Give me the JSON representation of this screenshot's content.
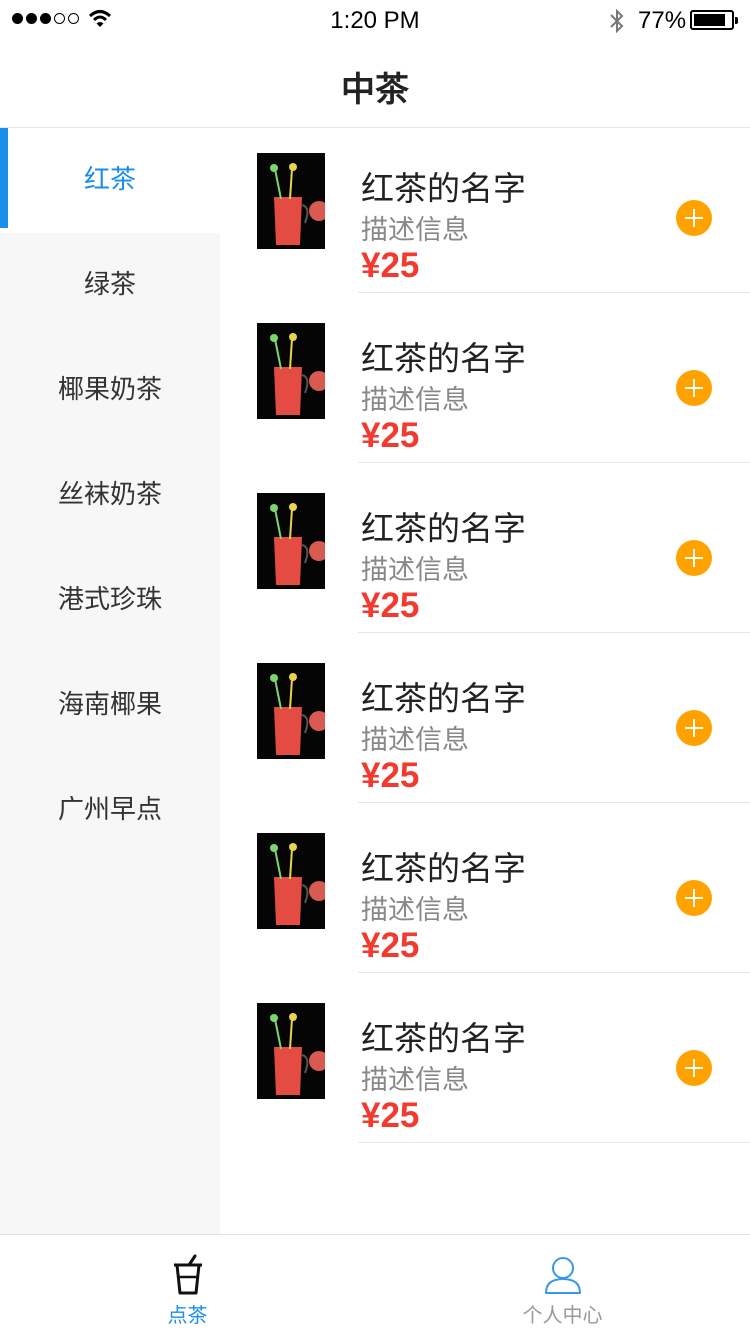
{
  "status_bar": {
    "time": "1:20 PM",
    "battery_percent": "77%",
    "battery_level": 0.77,
    "signal_bars_filled": 3,
    "signal_bars_total": 5,
    "icons": [
      "signal-dots-icon",
      "wifi-icon",
      "bluetooth-icon",
      "battery-icon"
    ]
  },
  "header": {
    "title": "中茶"
  },
  "sidebar": {
    "active_index": 0,
    "items": [
      {
        "label": "红茶"
      },
      {
        "label": "绿茶"
      },
      {
        "label": "椰果奶茶"
      },
      {
        "label": "丝袜奶茶"
      },
      {
        "label": "港式珍珠"
      },
      {
        "label": "海南椰果"
      },
      {
        "label": "广州早点"
      }
    ]
  },
  "products": [
    {
      "name": "红茶的名字",
      "desc": "描述信息",
      "price": "¥25"
    },
    {
      "name": "红茶的名字",
      "desc": "描述信息",
      "price": "¥25"
    },
    {
      "name": "红茶的名字",
      "desc": "描述信息",
      "price": "¥25"
    },
    {
      "name": "红茶的名字",
      "desc": "描述信息",
      "price": "¥25"
    },
    {
      "name": "红茶的名字",
      "desc": "描述信息",
      "price": "¥25"
    },
    {
      "name": "红茶的名字",
      "desc": "描述信息",
      "price": "¥25"
    }
  ],
  "tabbar": {
    "items": [
      {
        "label": "点茶",
        "icon": "cup-icon",
        "active": true
      },
      {
        "label": "个人中心",
        "icon": "person-icon",
        "active": false
      }
    ]
  },
  "colors": {
    "accent": "#1a8ee8",
    "price": "#f23a2f",
    "add_button": "#ffa200",
    "sidebar_bg": "#f7f7f7"
  }
}
